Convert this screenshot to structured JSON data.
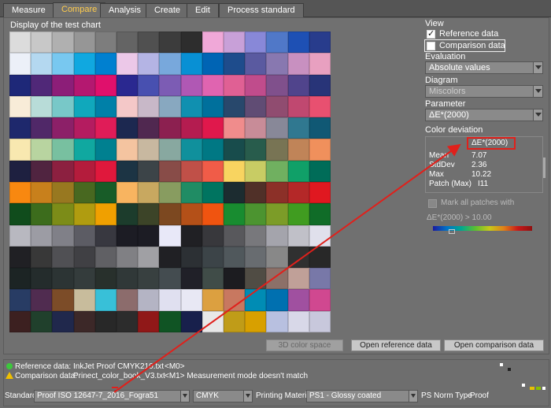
{
  "tabs": [
    {
      "label": "Measure",
      "active": false
    },
    {
      "label": "Compare",
      "active": true
    },
    {
      "label": "Analysis",
      "active": false
    },
    {
      "label": "Create",
      "active": false
    },
    {
      "label": "Edit",
      "active": false
    },
    {
      "label": "Process standard",
      "active": false
    }
  ],
  "chart": {
    "title": "Display of the test chart",
    "rows": [
      [
        "#dcdcdc",
        "#c8c8c8",
        "#b0b0b0",
        "#969696",
        "#7d7d7d",
        "#646464",
        "#505050",
        "#3c3c3c",
        "#2d2d2d",
        "#f0a8d8",
        "#c8a0d8",
        "#8888d8",
        "#5078c8",
        "#1e50b4",
        "#283c8c"
      ],
      [
        "#ecf0f8",
        "#b4d8f0",
        "#78c8f0",
        "#10a8e0",
        "#0080d0",
        "#ecc8e8",
        "#b4b4e4",
        "#78a8dc",
        "#0890d4",
        "#0064b4",
        "#1e4c8c",
        "#5a5aa0",
        "#8878b0",
        "#c890c0",
        "#e8a0c0"
      ],
      [
        "#1e2878",
        "#502878",
        "#8c1e78",
        "#b41870",
        "#e0106c",
        "#2a2890",
        "#4850b0",
        "#7c5cb4",
        "#b058b4",
        "#e064b0",
        "#e06094",
        "#c04c8c",
        "#80508c",
        "#50448c",
        "#283478"
      ],
      [
        "#f8ecd8",
        "#b8dcd8",
        "#78c8c8",
        "#10a8bc",
        "#0080a8",
        "#f4c8c8",
        "#c8b8c8",
        "#88a8c0",
        "#1090b0",
        "#00709c",
        "#28486c",
        "#604c74",
        "#904c70",
        "#c04870",
        "#e85070"
      ],
      [
        "#1e286c",
        "#502868",
        "#8c2068",
        "#b41c60",
        "#e01c58",
        "#1c2850",
        "#502850",
        "#8c2050",
        "#b41c50",
        "#e0184c",
        "#f08c8c",
        "#c88c98",
        "#888898",
        "#307890",
        "#105874"
      ],
      [
        "#f8e8b0",
        "#b8d4a0",
        "#78c0a0",
        "#10a8a0",
        "#008090",
        "#f4c4a0",
        "#c8b8a0",
        "#88a8a0",
        "#10909c",
        "#007884",
        "#184c4c",
        "#285c4c",
        "#787454",
        "#c08458",
        "#f0905c"
      ],
      [
        "#1e2040",
        "#502440",
        "#8c2040",
        "#b41c3c",
        "#e0183c",
        "#1c3444",
        "#3c4448",
        "#884c48",
        "#c05048",
        "#f05c48",
        "#f8d460",
        "#c8cc64",
        "#70b060",
        "#10a068",
        "#006c58"
      ],
      [
        "#f88810",
        "#c8801c",
        "#987820",
        "#486820",
        "#185c28",
        "#f8b460",
        "#c8a860",
        "#889c60",
        "#208c64",
        "#007460",
        "#1c2c30",
        "#503028",
        "#8c3028",
        "#b42828",
        "#e01820"
      ],
      [
        "#104c1c",
        "#3c6c1c",
        "#7c8c18",
        "#b09c10",
        "#f0a000",
        "#1c3c2c",
        "#3c4428",
        "#7c4820",
        "#b45018",
        "#f05410",
        "#188c30",
        "#4c9430",
        "#7c9c28",
        "#409c20",
        "#106c28"
      ],
      [
        "#b8b8c0",
        "#9c9ca4",
        "#808088",
        "#5c5c64",
        "#383840",
        "#1c1c24",
        "#1c1c24",
        "#e8e8f8",
        "#202024",
        "#38383c",
        "#58585c",
        "#78787c",
        "#a4a4ac",
        "#c0c0c8",
        "#e0e0ec"
      ],
      [
        "#202024",
        "#383838",
        "#505054",
        "#404044",
        "#606064",
        "#808084",
        "#a0a0a4",
        "#202024",
        "#2c3034",
        "#3c4448",
        "#50585c",
        "#686c70",
        "#888888",
        "#303030",
        "#282828"
      ],
      [
        "#1c2424",
        "#242c2c",
        "#2c3434",
        "#343c3c",
        "#28302c",
        "#303838",
        "#384040",
        "#444c50",
        "#202028",
        "#404c48",
        "#1c1c20",
        "#504c44",
        "#8c7068",
        "#c0a098",
        "#7878a8"
      ],
      [
        "#283c64",
        "#502c50",
        "#7c4c28",
        "#c8bc9c",
        "#38c0d8",
        "#8c6c6c",
        "#b4b4c4",
        "#e0e0f0",
        "#e8e8f4",
        "#dca040",
        "#c87860",
        "#008cb4",
        "#0070b0",
        "#a050a0",
        "#d04890"
      ],
      [
        "#3c2020",
        "#20402c",
        "#20284c",
        "#3c2828",
        "#282828",
        "#2c2c2c",
        "#901818",
        "#105424",
        "#18204c",
        "#e8e8e8",
        "#c09c18",
        "#d8a000",
        "#b8c0e0",
        "#d8d8e8",
        "#c8c8dc"
      ]
    ]
  },
  "view": {
    "header": "View",
    "reference_label": "Reference data",
    "reference_checked": true,
    "comparison_label": "Comparison data",
    "comparison_checked": false
  },
  "evaluation": {
    "header": "Evaluation",
    "value": "Absolute values"
  },
  "diagram": {
    "header": "Diagram",
    "value": "Miscolors"
  },
  "parameter": {
    "header": "Parameter",
    "value": "ΔE*(2000)"
  },
  "deviation": {
    "header": "Color deviation",
    "column_title": "ΔE*(2000)",
    "rows": [
      {
        "label": "Mean",
        "value": "7.07"
      },
      {
        "label": "StdDev",
        "value": "2.36"
      },
      {
        "label": "Max",
        "value": "10.22"
      },
      {
        "label": "Patch (Max)",
        "value": "I11"
      }
    ],
    "mark_label": "Mark all patches with",
    "threshold_label": "ΔE*(2000) > 10.00"
  },
  "buttons": {
    "color_space": "3D color space",
    "open_reference": "Open reference data",
    "open_comparison": "Open comparison data"
  },
  "bottom": {
    "reference_label": "Reference data:",
    "reference_value": "InkJet Proof CMYK210.txt",
    "reference_mode": "<M0>",
    "comparison_label": "Comparison data:",
    "comparison_value": "Prinect_color_book_V3.txt",
    "comparison_mode": "<M1> Measurement mode doesn't match",
    "standard_label": "Standard",
    "standard_value": "Proof  ISO 12647-7_2016_Fogra51",
    "colorspace_value": "CMYK",
    "material_label": "Printing Material",
    "material_value": "PS1 - Glossy coated",
    "norm_label": "PS Norm Type",
    "norm_value": "Proof"
  },
  "colors": {
    "accent_tab": "#ffcc4d",
    "annotation": "#e0201b",
    "ok_dot": "#3cc83c",
    "warn": "#f0c000"
  }
}
